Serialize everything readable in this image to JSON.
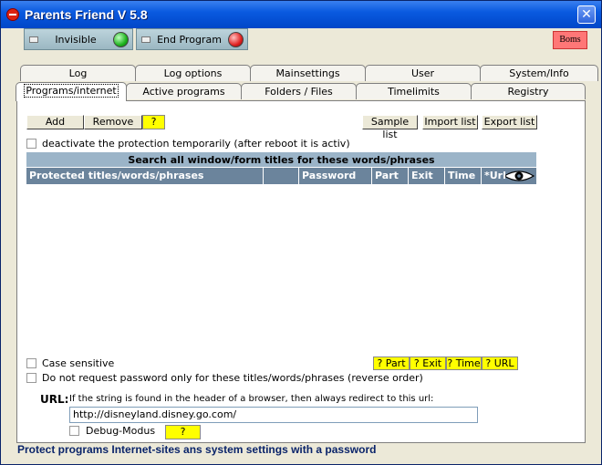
{
  "window": {
    "title": "Parents Friend V 5.8",
    "close_symbol": "✕"
  },
  "toolbar": {
    "invisible_label": "Invisible",
    "end_program_label": "End Program",
    "boms_label": "Boms"
  },
  "tabs_row1": [
    "Log",
    "Log options",
    "Mainsettings",
    "User",
    "System/Info"
  ],
  "tabs_row2": [
    "Programs/internet",
    "Active programs",
    "Folders / Files",
    "Timelimits",
    "Registry"
  ],
  "actions": {
    "add": "Add",
    "remove": "Remove",
    "help": "?",
    "sample_list": "Sample list",
    "import_list": "Import list",
    "export_list": "Export list"
  },
  "deactivate_label": "deactivate the protection temporarily (after reboot it is activ)",
  "grid": {
    "title": "Search all window/form titles for these words/phrases",
    "columns": [
      "Protected titles/words/phrases",
      "",
      "Password",
      "Part",
      "Exit",
      "Time",
      "*Url"
    ]
  },
  "options": {
    "case_sensitive": "Case sensitive",
    "reverse_order": "Do not request password only for these titles/words/phrases (reverse order)"
  },
  "help_buttons": [
    "? Part",
    "? Exit",
    "? Time",
    "? URL"
  ],
  "url": {
    "label": "URL:",
    "description": "If the string is found in the header of a browser, then always redirect to this url:",
    "value": "http://disneyland.disney.go.com/"
  },
  "debug": {
    "label": "Debug-Modus",
    "help": "?"
  },
  "status_text": "Protect programs Internet-sites ans system settings with a password"
}
